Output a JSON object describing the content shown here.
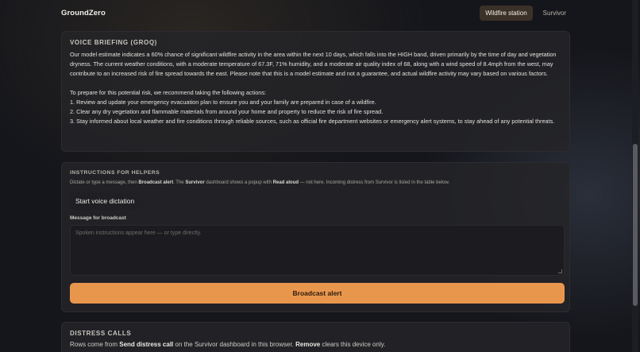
{
  "app": {
    "brand": "GroundZero",
    "nav": [
      {
        "label": "Wildfire station",
        "active": true
      },
      {
        "label": "Survivor",
        "active": false
      }
    ]
  },
  "voice_briefing": {
    "title": "VOICE BRIEFING (GROQ)",
    "paragraph1": "Our model estimate indicates a 60% chance of significant wildfire activity in the area within the next 10 days, which falls into the HIGH band, driven primarily by the time of day and vegetation dryness. The current weather conditions, with a moderate temperature of 67.3F, 71% humidity, and a moderate air quality index of 68, along with a wind speed of 8.4mph from the west, may contribute to an increased risk of fire spread towards the east. Please note that this is a model estimate and not a guarantee, and actual wildfire activity may vary based on various factors.",
    "intro": "To prepare for this potential risk, we recommend taking the following actions:",
    "actions": [
      "1. Review and update your emergency evacuation plan to ensure you and your family are prepared in case of a wildfire.",
      "2. Clear any dry vegetation and flammable materials from around your home and property to reduce the risk of fire spread.",
      "3. Stay informed about local weather and fire conditions through reliable sources, such as official fire department websites or emergency alert systems, to stay ahead of any potential threats."
    ]
  },
  "helpers": {
    "title": "INSTRUCTIONS FOR HELPERS",
    "desc_1": "Dictate or type a message, then ",
    "desc_b1": "Broadcast alert",
    "desc_2": ". The ",
    "desc_b2": "Survivor",
    "desc_3": " dashboard shows a popup with ",
    "desc_b3": "Read aloud",
    "desc_4": " — not here. Incoming distress from Survivor is listed in the table below.",
    "voice_button": "Start voice dictation",
    "message_label": "Message for broadcast",
    "message_value": "",
    "message_placeholder": "Spoken instructions appear here — or type directly.",
    "broadcast_button": "Broadcast alert"
  },
  "distress": {
    "title": "DISTRESS CALLS",
    "desc_1": "Rows come from ",
    "desc_b1": "Send distress call",
    "desc_2": " on the Survivor dashboard in this browser. ",
    "desc_b2": "Remove",
    "desc_3": " clears this device only."
  },
  "colors": {
    "accent": "#e9964d",
    "active_tab_bg": "#3b3128",
    "background": "#15161b"
  }
}
